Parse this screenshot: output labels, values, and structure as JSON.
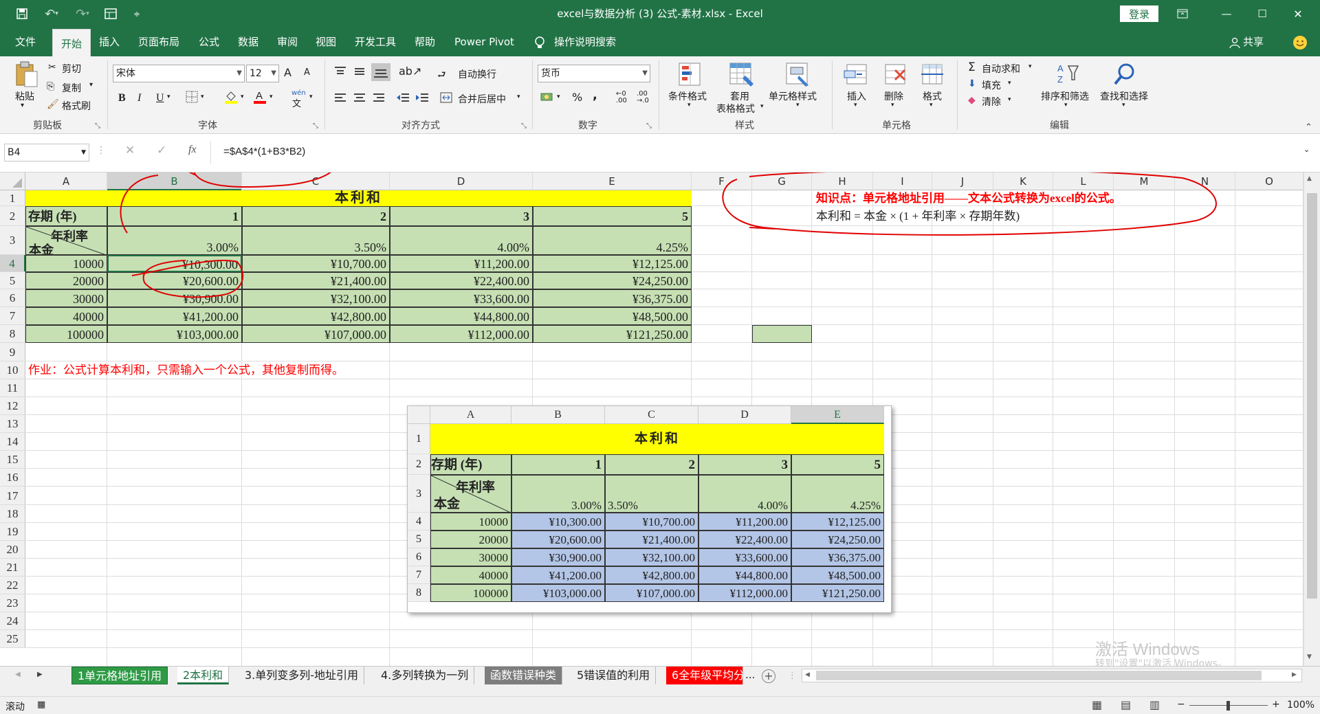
{
  "titlebar": {
    "title": "excel与数据分析 (3) 公式-素材.xlsx  -  Excel",
    "login": "登录",
    "min": "—",
    "max": "☐",
    "close": "✕"
  },
  "menu": {
    "items": [
      "文件",
      "开始",
      "插入",
      "页面布局",
      "公式",
      "数据",
      "审阅",
      "视图",
      "开发工具",
      "帮助",
      "Power Pivot",
      "操作说明搜索"
    ],
    "share": "共享"
  },
  "ribbon": {
    "clipboard": {
      "paste": "粘贴",
      "cut": "剪切",
      "copy": "复制",
      "painter": "格式刷",
      "group": "剪贴板"
    },
    "font": {
      "name": "宋体",
      "size": "12",
      "group": "字体",
      "bold": "B",
      "italic": "I",
      "underline": "U",
      "grow": "A",
      "shrink": "A",
      "wen": "wén"
    },
    "align": {
      "wrap": "自动换行",
      "merge": "合并后居中",
      "group": "对齐方式"
    },
    "number": {
      "format": "货币",
      "group": "数字",
      "pct": "%",
      "comma": ","
    },
    "styles": {
      "cond": "条件格式",
      "table1": "套用",
      "table2": "表格格式",
      "cell": "单元格样式",
      "group": "样式"
    },
    "cells": {
      "insert": "插入",
      "delete": "删除",
      "format": "格式",
      "group": "单元格"
    },
    "edit": {
      "autosum": "自动求和",
      "fill": "填充",
      "clear": "清除",
      "sort": "排序和筛选",
      "find": "查找和选择",
      "group": "编辑"
    }
  },
  "formula": {
    "namebox": "B4",
    "fx": "fx",
    "content": "=$A$4*(1+B3*B2)"
  },
  "columns": [
    "A",
    "B",
    "C",
    "D",
    "E",
    "F",
    "G",
    "H",
    "I",
    "J",
    "K",
    "L",
    "M",
    "N",
    "O"
  ],
  "rows": [
    "1",
    "2",
    "3",
    "4",
    "5",
    "6",
    "7",
    "8",
    "9",
    "10",
    "11",
    "12",
    "13",
    "14",
    "15",
    "16",
    "17",
    "18",
    "19",
    "20",
    "21",
    "22",
    "23",
    "24",
    "25"
  ],
  "sheet": {
    "title": "本利和",
    "period_label": "存期 (年)",
    "periods": [
      "1",
      "2",
      "3",
      "5"
    ],
    "rate_label": "年利率",
    "principal_label": "本金",
    "rates": [
      "3.00%",
      "3.50%",
      "4.00%",
      "4.25%"
    ],
    "principals": [
      "10000",
      "20000",
      "30000",
      "40000",
      "100000"
    ],
    "values": [
      [
        "¥10,300.00",
        "¥10,700.00",
        "¥11,200.00",
        "¥12,125.00"
      ],
      [
        "¥20,600.00",
        "¥21,400.00",
        "¥22,400.00",
        "¥24,250.00"
      ],
      [
        "¥30,900.00",
        "¥32,100.00",
        "¥33,600.00",
        "¥36,375.00"
      ],
      [
        "¥41,200.00",
        "¥42,800.00",
        "¥44,800.00",
        "¥48,500.00"
      ],
      [
        "¥103,000.00",
        "¥107,000.00",
        "¥112,000.00",
        "¥121,250.00"
      ]
    ],
    "note1": "知识点：单元格地址引用——文本公式转换为excel的公式。",
    "note2": "本利和 = 本金 × (1 + 年利率 × 存期年数)",
    "homework": "作业：公式计算本利和，只需输入一个公式，其他复制而得。"
  },
  "picture": {
    "cols": [
      "A",
      "B",
      "C",
      "D",
      "E"
    ],
    "rows": [
      "1",
      "2",
      "3",
      "4",
      "5",
      "6",
      "7",
      "8"
    ]
  },
  "tabs": {
    "items": [
      "1单元格地址引用",
      "2本利和",
      "3.单列变多列-地址引用",
      "4.多列转换为一列",
      "函数错误种类",
      "5错误值的利用",
      "6全年级平均分"
    ],
    "more": "...",
    "add": "+"
  },
  "status": {
    "mode": "滚动",
    "zoom": "100%"
  },
  "watermark": {
    "line1": "激活 Windows",
    "line2": "转到\"设置\"以激活 Windows。"
  },
  "colors": {
    "excel_green": "#217346",
    "title_yellow": "#ffff00",
    "cell_green": "#c6e0b4",
    "cell_blue": "#b4c6e7",
    "red": "#ff0000"
  }
}
